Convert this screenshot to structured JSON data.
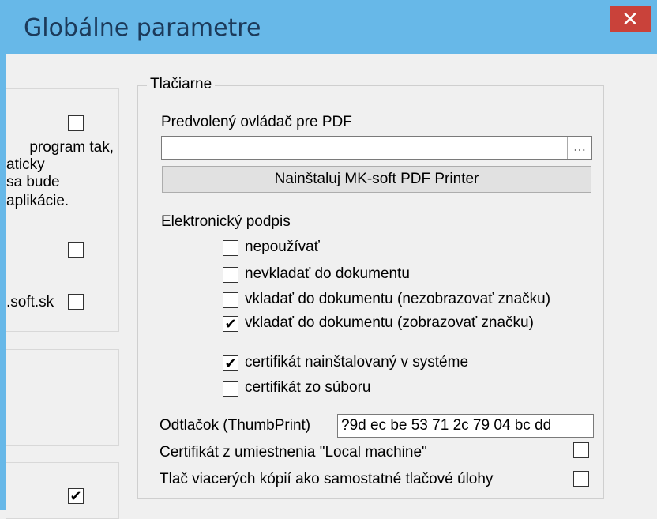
{
  "window": {
    "title": "Globálne parametre",
    "close_glyph": "✕"
  },
  "left_panel": {
    "text_lines": [
      "program tak,",
      "aticky",
      "sa bude",
      "aplikácie."
    ],
    "domain_text": ".soft.sk"
  },
  "printers": {
    "group_title": "Tlačiarne",
    "pdf_driver_label": "Predvolený ovládač pre PDF",
    "pdf_driver_value": "",
    "browse_glyph": "...",
    "install_button": "Nainštaluj MK-soft PDF Printer",
    "esign_label": "Elektronický podpis",
    "options": [
      {
        "label": "nepoužívať",
        "checked": false
      },
      {
        "label": "nevkladať do dokumentu",
        "checked": false
      },
      {
        "label": "vkladať do dokumentu (nezobrazovať značku)",
        "checked": false
      },
      {
        "label": "vkladať do dokumentu (zobrazovať značku)",
        "checked": true
      }
    ],
    "cert_options": [
      {
        "label": "certifikát nainštalovaný v systéme",
        "checked": true
      },
      {
        "label": "certifikát zo súboru",
        "checked": false
      }
    ],
    "thumbprint_label": "Odtlačok (ThumbPrint)",
    "thumbprint_value": "?9d ec be 53 71 2c 79 04 bc dd",
    "local_machine_label": "Certifikát z umiestnenia \"Local machine\"",
    "local_machine_checked": false,
    "multi_copy_label": "Tlač viacerých kópií ako samostatné tlačové úlohy",
    "multi_copy_checked": false
  },
  "check_glyph": "✔"
}
